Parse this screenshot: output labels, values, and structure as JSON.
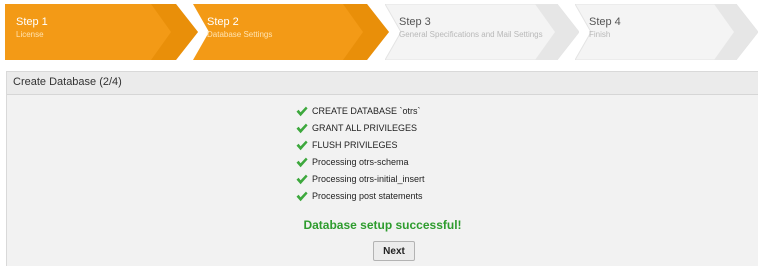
{
  "steps": [
    {
      "title": "Step 1",
      "subtitle": "License",
      "state": "completed"
    },
    {
      "title": "Step 2",
      "subtitle": "Database Settings",
      "state": "active"
    },
    {
      "title": "Step 3",
      "subtitle": "General Specifications and Mail Settings",
      "state": "pending"
    },
    {
      "title": "Step 4",
      "subtitle": "Finish",
      "state": "pending"
    }
  ],
  "panel": {
    "title": "Create Database (2/4)",
    "results": [
      {
        "label": "CREATE DATABASE `otrs`",
        "icon": "check-icon",
        "status": "ok"
      },
      {
        "label": "GRANT ALL PRIVILEGES",
        "icon": "check-icon",
        "status": "ok"
      },
      {
        "label": "FLUSH PRIVILEGES",
        "icon": "check-icon",
        "status": "ok"
      },
      {
        "label": "Processing otrs-schema",
        "icon": "check-icon",
        "status": "ok"
      },
      {
        "label": "Processing otrs-initial_insert",
        "icon": "check-icon",
        "status": "ok"
      },
      {
        "label": "Processing post statements",
        "icon": "check-icon",
        "status": "ok"
      }
    ],
    "success_message": "Database setup successful!",
    "next_label": "Next"
  },
  "colors": {
    "step_active": "#f39a16",
    "step_active_dark": "#e08700",
    "step_pending": "#f4f4f4",
    "success_text": "#2e9c2e",
    "check": "#3da83d"
  }
}
